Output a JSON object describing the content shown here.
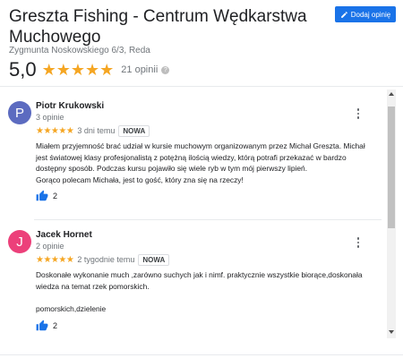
{
  "business": {
    "title": "Greszta Fishing - Centrum Wędkarstwa Muchowego",
    "address": "Zygmunta Noskowskiego 6/3, Reda",
    "add_review_label": "Dodaj opinię",
    "rating": "5,0",
    "stars": "★★★★★",
    "review_count": "21 opinii",
    "help_icon": "?"
  },
  "colors": {
    "accent": "#1a73e8",
    "star": "#f5a623",
    "avatar_p": "#5c6bc0",
    "avatar_j": "#ec407a"
  },
  "reviews": [
    {
      "initial": "P",
      "name": "Piotr Krukowski",
      "sub": "3 opinie",
      "stars": "★★★★★",
      "time": "3 dni temu",
      "badge": "NOWA",
      "text": "Miałem przyjemność brać udział w kursie muchowym organizowanym przez Michał Greszta. Michał jest światowej klasy profesjonalistą z potężną ilością wiedzy, którą potrafi przekazać w bardzo dostępny sposób. Podczas kursu pojawiło się wiele ryb w tym mój pierwszy lipień.\nGorąco polecam Michała, jest to gość, który zna się na rzeczy!",
      "likes": "2"
    },
    {
      "initial": "J",
      "name": "Jacek Hornet",
      "sub": "2 opinie",
      "stars": "★★★★★",
      "time": "2 tygodnie temu",
      "badge": "NOWA",
      "text": "Doskonałe wykonanie much ,zarówno suchych jak i nimf. praktycznie wszystkie biorące,doskonała wiedza na temat rzek pomorskich.\n\npomorskich,dzielenie",
      "likes": "2"
    }
  ]
}
